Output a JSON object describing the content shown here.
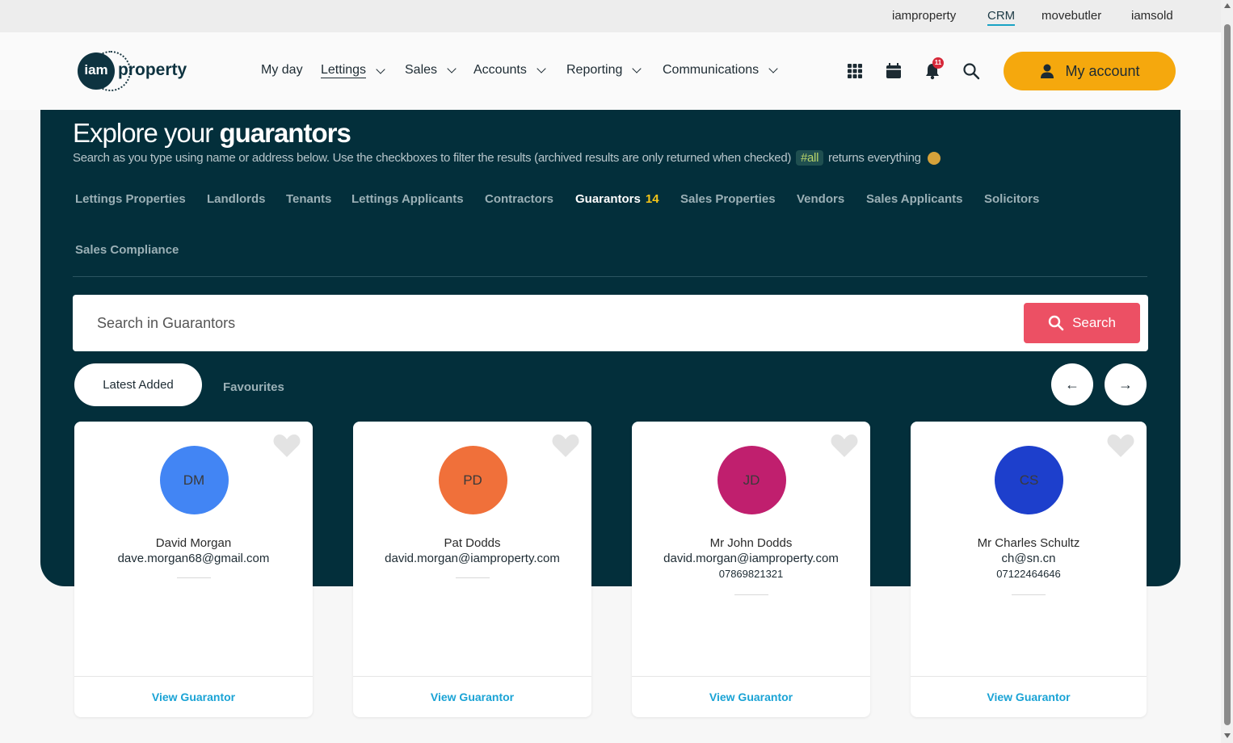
{
  "topbar": {
    "links": [
      "iamproperty",
      "CRM",
      "movebutler",
      "iamsold"
    ],
    "active": "CRM"
  },
  "brand": {
    "mark": "iam",
    "word": "property"
  },
  "nav": {
    "items": [
      {
        "label": "My day",
        "dropdown": false
      },
      {
        "label": "Lettings",
        "dropdown": true,
        "active": true
      },
      {
        "label": "Sales",
        "dropdown": true
      },
      {
        "label": "Accounts",
        "dropdown": true
      },
      {
        "label": "Reporting",
        "dropdown": true
      },
      {
        "label": "Communications",
        "dropdown": true
      }
    ],
    "notification_count": "11",
    "my_account": "My account"
  },
  "hero": {
    "title_plain": "Explore your ",
    "title_bold": "guarantors",
    "subtitle_before": "Search as you type using name or address below. Use the checkboxes to filter the results (archived results are only returned when checked)",
    "subtitle_tag": "#all",
    "subtitle_after": "returns everything"
  },
  "tabs": [
    {
      "label": "Lettings Properties"
    },
    {
      "label": "Landlords"
    },
    {
      "label": "Tenants"
    },
    {
      "label": "Lettings Applicants"
    },
    {
      "label": "Contractors"
    },
    {
      "label": "Guarantors",
      "count": "14",
      "active": true
    },
    {
      "label": "Sales Properties"
    },
    {
      "label": "Vendors"
    },
    {
      "label": "Sales Applicants"
    },
    {
      "label": "Solicitors"
    },
    {
      "label": "Sales Compliance"
    }
  ],
  "search": {
    "placeholder": "Search in Guarantors",
    "button": "Search"
  },
  "filters": {
    "latest": "Latest Added",
    "favourites": "Favourites",
    "prev": "←",
    "next": "→"
  },
  "cards": [
    {
      "initials": "DM",
      "color": "#4285f4",
      "name": "David Morgan",
      "email": "dave.morgan68@gmail.com",
      "phone": "",
      "link": "View Guarantor"
    },
    {
      "initials": "PD",
      "color": "#f0703a",
      "name": "Pat Dodds",
      "email": "david.morgan@iamproperty.com",
      "phone": "",
      "link": "View Guarantor"
    },
    {
      "initials": "JD",
      "color": "#c01f6e",
      "name": "Mr John Dodds",
      "email": "david.morgan@iamproperty.com",
      "phone": "07869821321",
      "link": "View Guarantor"
    },
    {
      "initials": "CS",
      "color": "#1d3fcc",
      "name": "Mr Charles Schultz",
      "email": "ch@sn.cn",
      "phone": "07122464646",
      "link": "View Guarantor"
    }
  ],
  "colors": {
    "hero_bg": "#032f3b",
    "accent_yellow": "#f5a80d",
    "search_red": "#ec5064",
    "link_blue": "#1aa3d5"
  }
}
